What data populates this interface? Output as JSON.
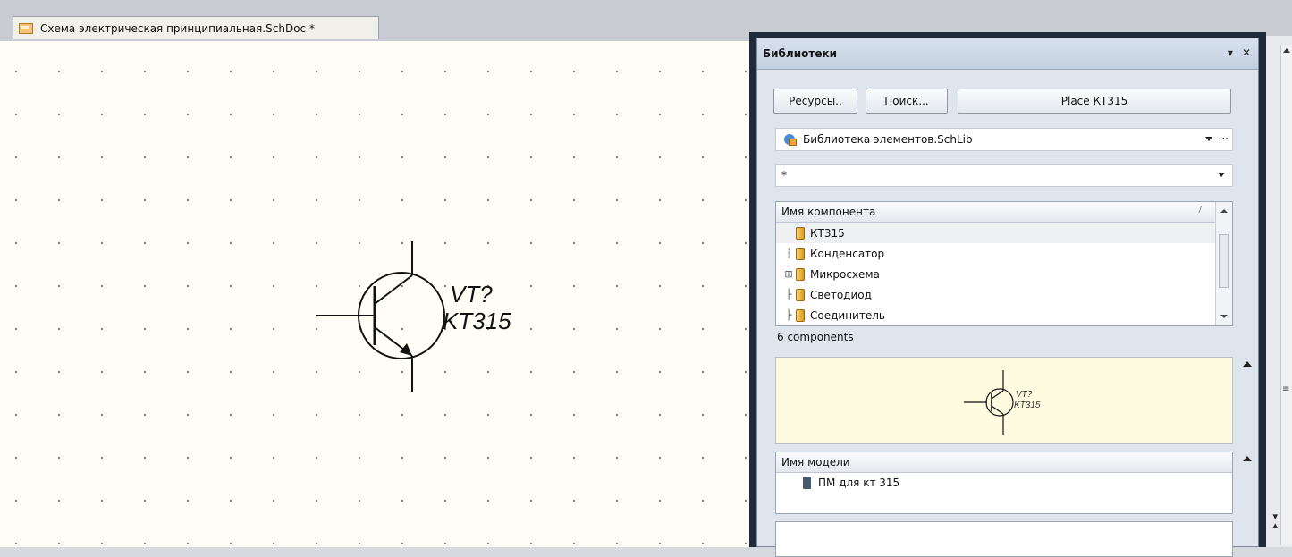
{
  "document": {
    "tab_title": "Схема электрическая принципиальная.SchDoc *"
  },
  "schematic": {
    "designator": "VT?",
    "comment": "KT315"
  },
  "libraries_panel": {
    "title": "Библиотеки",
    "title_controls": [
      "▾",
      "✕"
    ],
    "buttons": {
      "resources": "Ресурсы..",
      "search": "Поиск...",
      "place": "Place КТ315"
    },
    "library_select": {
      "value": "Библиотека элементов.SchLib",
      "ellipsis": "···"
    },
    "filter": {
      "value": "*"
    },
    "components": {
      "header": "Имя компонента",
      "sort_indicator": "/",
      "items": [
        {
          "tree": "",
          "name": "КТ315"
        },
        {
          "tree": "┆",
          "name": "Конденсатор"
        },
        {
          "tree": "⊞",
          "name": "Микросхема"
        },
        {
          "tree": "├",
          "name": "Светодиод"
        },
        {
          "tree": "├",
          "name": "Соединитель"
        }
      ],
      "count_text": "6 components"
    },
    "preview": {
      "designator": "VT?",
      "comment": "KT315"
    },
    "models": {
      "header": "Имя модели",
      "items": [
        {
          "name": "ПМ для кт 315"
        }
      ]
    }
  },
  "icons": {
    "doc_tab": "schematic-document-icon",
    "library": "library-icon",
    "component": "component-icon",
    "model": "footprint-model-icon"
  },
  "colors": {
    "panel_frame": "#1f2b3a",
    "sheet_background": "#fffdf6",
    "preview_background": "#fdfbe0"
  }
}
